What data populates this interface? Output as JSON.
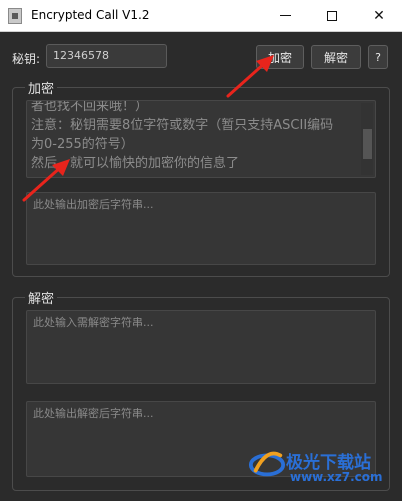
{
  "window": {
    "title": "Encrypted Call V1.2",
    "minimize_glyph": "—",
    "close_glyph": "✕"
  },
  "key": {
    "label": "秘钥:",
    "value": "12346578"
  },
  "toolbar": {
    "encrypt_label": "加密",
    "decrypt_label": "解密",
    "help_label": "?"
  },
  "encrypt_group": {
    "title": "加密",
    "plaintext_lines": [
      "者也找不回来哦！）",
      "注意：秘钥需要8位字符或数字（暂只支持ASCII编码",
      "为0-255的符号）",
      "然后，就可以愉快的加密你的信息了"
    ],
    "output_placeholder": "此处输出加密后字符串..."
  },
  "decrypt_group": {
    "title": "解密",
    "input_placeholder": "此处输入需解密字符串...",
    "output_placeholder": "此处输出解密后字符串..."
  },
  "watermark": {
    "name": "极光下载站",
    "url": "www.xz7.com"
  },
  "colors": {
    "background": "#2b2b2b",
    "arrow": "#e8241c",
    "watermark": "#2a6fd6"
  }
}
